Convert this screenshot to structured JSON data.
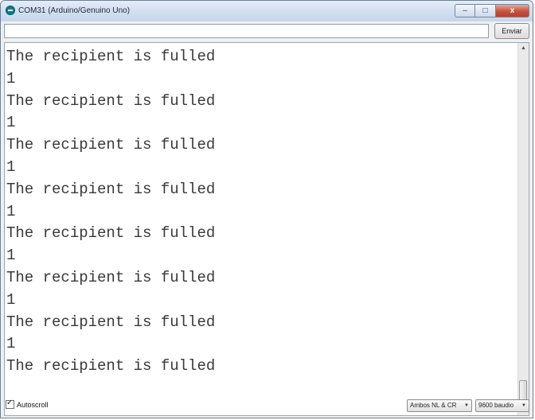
{
  "window": {
    "title": "COM31 (Arduino/Genuino Uno)",
    "controls": {
      "minimize": "–",
      "maximize": "□",
      "close": "x"
    }
  },
  "send": {
    "input_value": "",
    "button_label": "Enviar"
  },
  "output": {
    "lines": [
      "The recipient is fulled",
      "1",
      "The recipient is fulled",
      "1",
      "The recipient is fulled",
      "1",
      "The recipient is fulled",
      "1",
      "The recipient is fulled",
      "1",
      "The recipient is fulled",
      "1",
      "The recipient is fulled",
      "1",
      "The recipient is fulled"
    ]
  },
  "footer": {
    "autoscroll_label": "Autoscroll",
    "autoscroll_checked": true,
    "line_ending": "Ambos NL & CR",
    "baud_rate": "9600 baudio"
  }
}
